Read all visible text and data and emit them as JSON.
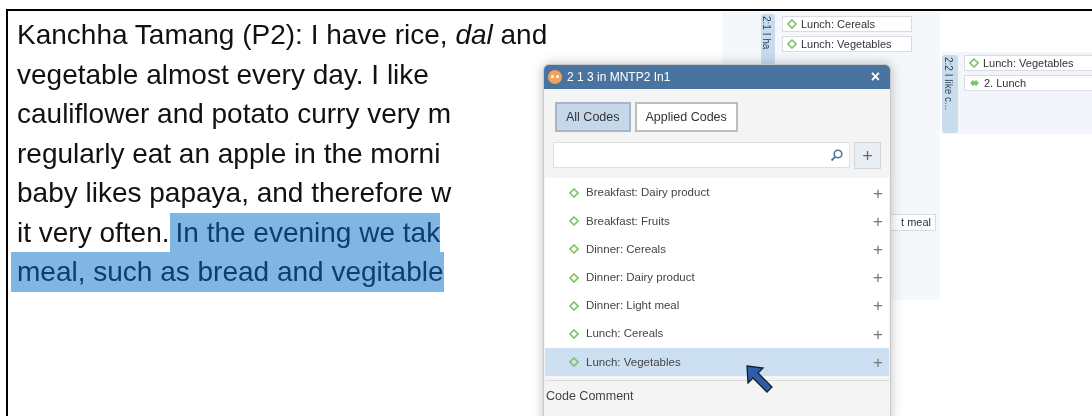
{
  "document": {
    "lines": [
      {
        "segments": [
          {
            "text": "Kanchha Tamang (P2): I have rice, *dal* and",
            "highlighted": false
          }
        ]
      },
      {
        "segments": [
          {
            "text": "vegetable almost every day. I like",
            "highlighted": false
          }
        ]
      },
      {
        "segments": [
          {
            "text": "cauliflower and potato curry very m",
            "highlighted": false
          }
        ]
      },
      {
        "segments": [
          {
            "text": "regularly eat an apple in the morni",
            "highlighted": false
          }
        ]
      },
      {
        "segments": [
          {
            "text": "baby likes papaya, and therefore w",
            "highlighted": false
          }
        ]
      },
      {
        "segments": [
          {
            "text": "it very often.",
            "highlighted": false
          },
          {
            "text": "In the evening we tak",
            "highlighted": true
          }
        ]
      },
      {
        "segments": [
          {
            "text": "meal, such as bread and vegitable",
            "highlighted": true
          }
        ]
      }
    ]
  },
  "margin": {
    "quotations": [
      {
        "label": "2:1 I ha",
        "codes": [
          {
            "kind": "code",
            "text": "Lunch: Cereals"
          },
          {
            "kind": "code",
            "text": "Lunch: Vegetables"
          }
        ]
      },
      {
        "label": "2:2 I like c...",
        "codes": [
          {
            "kind": "code",
            "text": "Lunch: Vegetables"
          },
          {
            "kind": "group",
            "text": "2. Lunch"
          }
        ]
      }
    ],
    "partial_code": "t meal"
  },
  "popup": {
    "title": "2 1 3 in MNTP2 In1",
    "close": "×",
    "tabs": [
      {
        "label": "All Codes",
        "selected": true
      },
      {
        "label": "Applied Codes",
        "selected": false
      }
    ],
    "add_button": "+",
    "codes": [
      {
        "name": "Breakfast: Dairy product",
        "selected": false
      },
      {
        "name": "Breakfast: Fruits",
        "selected": false
      },
      {
        "name": "Dinner: Cereals",
        "selected": false
      },
      {
        "name": "Dinner: Dairy product",
        "selected": false
      },
      {
        "name": "Dinner: Light meal",
        "selected": false
      },
      {
        "name": "Lunch: Cereals",
        "selected": false
      },
      {
        "name": "Lunch: Vegetables",
        "selected": true
      }
    ],
    "row_add": "+",
    "comment_label": "Code Comment"
  }
}
